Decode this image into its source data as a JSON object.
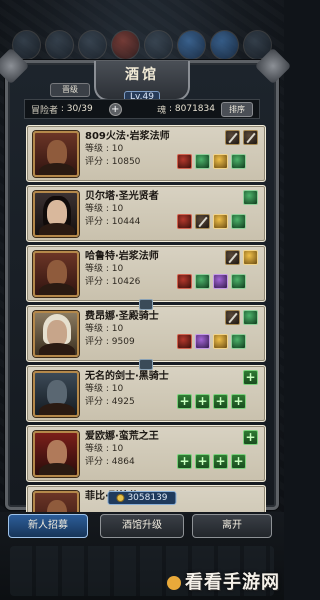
{
  "header": {
    "title": "酒馆",
    "level": "Lv.49",
    "team_label": "晋级"
  },
  "stats": {
    "recruit_label": "冒险者",
    "recruit_count": "30/39",
    "soul_label": "魂",
    "soul_value": "8071834",
    "sort_label": "排序"
  },
  "stat_labels": {
    "level": "等级 : ",
    "score": "评分 : "
  },
  "heroes": [
    {
      "name": "809火法·岩浆法师",
      "level": "10",
      "score": "10850",
      "slots": [
        "weapon",
        "weapon",
        "red",
        "gem",
        "gold",
        "gem"
      ]
    },
    {
      "name": "贝尔塔·圣光贤者",
      "level": "10",
      "score": "10444",
      "slots": [
        "empty",
        "gem",
        "red",
        "weapon",
        "gold",
        "gem"
      ]
    },
    {
      "name": "哈鲁特·岩浆法师",
      "level": "10",
      "score": "10426",
      "slots": [
        "weapon",
        "gold",
        "red",
        "gem",
        "purple",
        "gem"
      ]
    },
    {
      "name": "费昂娜·圣殿骑士",
      "level": "10",
      "score": "9509",
      "slots": [
        "weapon",
        "gem",
        "red",
        "purple",
        "gold",
        "gem"
      ]
    },
    {
      "name": "无名的剑士·黑骑士",
      "level": "10",
      "score": "4925",
      "slots": [
        "empty",
        "plus",
        "plus",
        "plus",
        "plus",
        "plus"
      ]
    },
    {
      "name": "爱欧娜·蛮荒之王",
      "level": "10",
      "score": "4864",
      "slots": [
        "empty",
        "plus",
        "plus",
        "plus",
        "plus",
        "plus"
      ]
    },
    {
      "name": "菲比·烈枪侠",
      "level": "",
      "score": "",
      "slots": []
    }
  ],
  "gold_value": "3058139",
  "bottom": {
    "recruit_button": "新人招募",
    "upgrade_button": "酒馆升级",
    "leave_button": "离开"
  },
  "watermark": "看看手游网",
  "colors": {
    "primary_button": "#2c5d99",
    "card": "#d8d2c2",
    "plus_green": "#2f7a33"
  }
}
